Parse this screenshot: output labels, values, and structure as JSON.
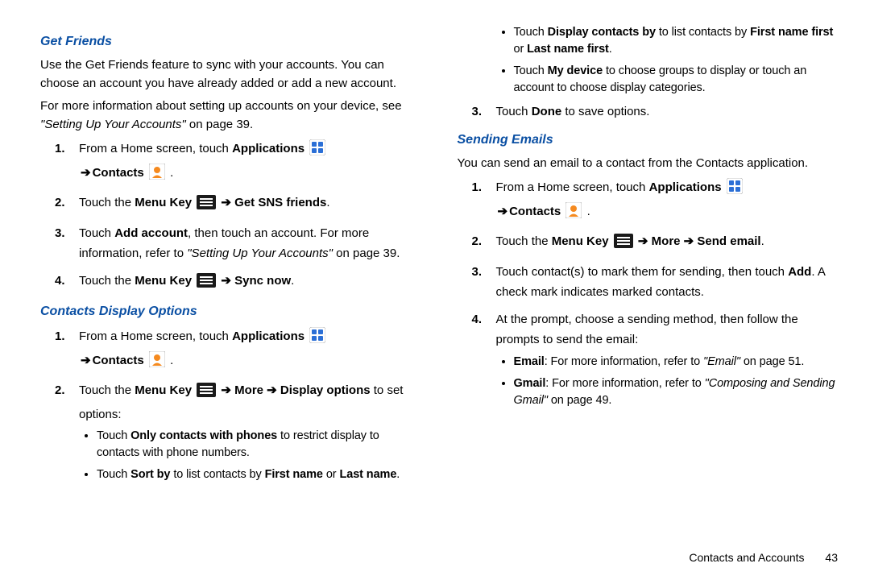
{
  "left": {
    "h1": "Get Friends",
    "p1": "Use the Get Friends feature to sync with your accounts. You can choose an account you have already added or add a new account.",
    "p2a": "For more information about setting up accounts on your device, see ",
    "p2_ref": "\"Setting Up Your Accounts\"",
    "p2b": " on page 39.",
    "s1_a": "From a Home screen, touch ",
    "s1_apps": "Applications",
    "s1_arrow": "➔",
    "s1_contacts": "Contacts",
    "s1_dot": " .",
    "s2_a": "Touch the ",
    "s2_mk": "Menu Key",
    "s2_arrow": " ➔ ",
    "s2_b": "Get SNS friends",
    "s2_dot": ".",
    "s3_a": "Touch ",
    "s3_b": "Add account",
    "s3_c": ", then touch an account. For more information, refer to ",
    "s3_ref": "\"Setting Up Your Accounts\" ",
    "s3_d": " on page 39.",
    "s4_a": "Touch the ",
    "s4_mk": "Menu Key",
    "s4_arrow": " ➔ ",
    "s4_b": "Sync now",
    "s4_dot": ".",
    "h2": "Contacts Display Options",
    "c1_a": "From a Home screen, touch ",
    "c1_apps": "Applications",
    "c1_arrow": "➔",
    "c1_contacts": "Contacts",
    "c1_dot": " .",
    "c2_a": "Touch the ",
    "c2_mk": "Menu Key",
    "c2_arrow": " ➔ ",
    "c2_more": "More",
    "c2_arrow2": " ➔ ",
    "c2_disp": "Display options",
    "c2_b": " to set options:",
    "b1_a": "Touch ",
    "b1_b": "Only contacts with phones",
    "b1_c": " to restrict display to contacts with phone numbers.",
    "b2_a": "Touch ",
    "b2_b": "Sort by",
    "b2_c": " to list contacts by ",
    "b2_d": "First name",
    "b2_e": " or ",
    "b2_f": "Last name",
    "b2_g": "."
  },
  "right": {
    "rb1_a": "Touch ",
    "rb1_b": "Display contacts by",
    "rb1_c": " to list contacts by ",
    "rb1_d": "First name first",
    "rb1_e": " or ",
    "rb1_f": "Last name first",
    "rb1_g": ".",
    "rb2_a": "Touch ",
    "rb2_b": "My device",
    "rb2_c": " to choose groups to display or touch an account to choose display categories.",
    "r3_a": "Touch ",
    "r3_b": "Done",
    "r3_c": " to save options.",
    "h3": "Sending Emails",
    "p3": "You can send an email to a contact from the Contacts application.",
    "e1_a": "From a Home screen, touch ",
    "e1_apps": "Applications",
    "e1_arrow": "➔ ",
    "e1_contacts": "Contacts",
    "e1_dot": " .",
    "e2_a": "Touch the ",
    "e2_mk": "Menu Key",
    "e2_arrow": " ➔ ",
    "e2_more": "More",
    "e2_arrow2": " ➔ ",
    "e2_send": "Send email",
    "e2_dot": ".",
    "e3_a": "Touch contact(s) to mark them for sending, then touch ",
    "e3_b": "Add",
    "e3_c": ". A check mark indicates marked contacts.",
    "e4_a": "At the prompt, choose a sending method, then follow the prompts to send the email:",
    "eb1_a": "Email",
    "eb1_b": ": For more information, refer to ",
    "eb1_ref": "\"Email\" ",
    "eb1_c": " on page 51.",
    "eb2_a": "Gmail",
    "eb2_b": ": For more information, refer to ",
    "eb2_ref": "\"Composing and Sending Gmail\" ",
    "eb2_c": " on page 49."
  },
  "footer": {
    "section": "Contacts and Accounts",
    "page": "43"
  }
}
